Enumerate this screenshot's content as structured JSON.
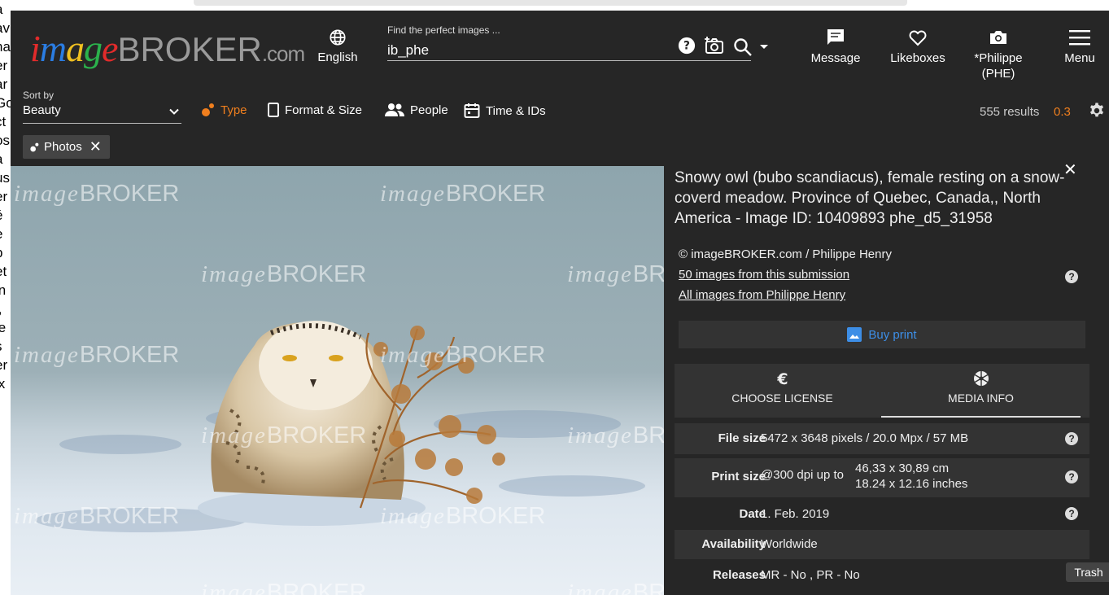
{
  "brand": {
    "logo_i": "image",
    "logo_broker": "BROKER",
    "logo_com": ".com"
  },
  "header": {
    "language": "English",
    "search_label": "Find the perfect images ...",
    "search_value": "ib_phe",
    "message": "Message",
    "likeboxes": "Likeboxes",
    "account_line1": "*Philippe",
    "account_line2": "(PHE)",
    "menu": "Menu"
  },
  "filters": {
    "sort_label": "Sort by",
    "sort_value": "Beauty",
    "type": "Type",
    "format_size": "Format & Size",
    "people": "People",
    "time_ids": "Time & IDs",
    "results": "555 results",
    "results_extra": "0.3",
    "active_chip": "Photos",
    "chip_close": "✕"
  },
  "photo": {
    "watermark_i": "image",
    "watermark_b": "BROKER"
  },
  "detail": {
    "close": "✕",
    "title": "Snowy owl (bubo scandiacus), female resting on a snow-coverd meadow. Province of Quebec, Canada,, North America - Image ID: 10409893 phe_d5_31958",
    "credit": "© imageBROKER.com / Philippe Henry",
    "link_submission": "50 images from this submission",
    "link_author": "All images from Philippe Henry",
    "help": "?",
    "buy_print": "Buy print",
    "tab_license": "CHOOSE LICENSE",
    "tab_media": "MEDIA INFO",
    "info": {
      "file_size_k": "File size",
      "file_size_v": "5472 x 3648 pixels / 20.0 Mpx / 57 MB",
      "print_size_k": "Print size",
      "print_size_prefix": "@300 dpi up to",
      "print_size_cm": "46,33 x 30,89 cm",
      "print_size_in": "18.24 x 12.16 inches",
      "date_k": "Date",
      "date_v": "1. Feb. 2019",
      "availability_k": "Availability",
      "availability_v": "Worldwide",
      "releases_k": "Releases",
      "releases_v": "MR - No , PR - No"
    }
  },
  "tooltip": {
    "trash": "Trash"
  },
  "bg_strip": [
    "a",
    "av",
    "ha",
    "er",
    "ar",
    "Go",
    "ct",
    "os",
    "a",
    "us",
    "er",
    "é",
    "e",
    "p",
    "et",
    "in",
    "i,",
    "le",
    "s",
    "er",
    "ix"
  ],
  "colors": {
    "accent": "#f07f1e",
    "link_blue": "#3d8ee6",
    "bg": "#262626"
  }
}
